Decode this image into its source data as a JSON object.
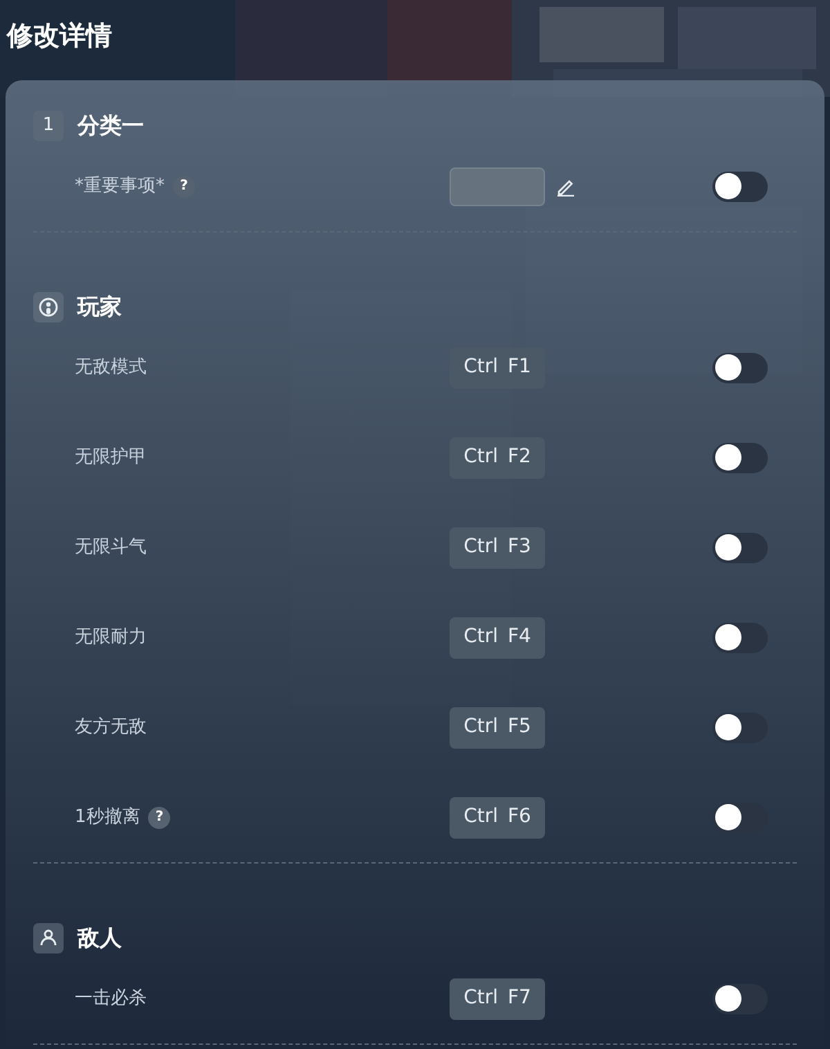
{
  "title": "修改详情",
  "sections": [
    {
      "badge": {
        "kind": "number",
        "text": "1"
      },
      "title": "分类一",
      "rows": [
        {
          "label": "*重要事项*",
          "help": "?",
          "control": {
            "kind": "input"
          },
          "on": false
        }
      ]
    },
    {
      "badge": {
        "kind": "player"
      },
      "title": "玩家",
      "rows": [
        {
          "label": "无敌模式",
          "control": {
            "kind": "hotkey",
            "keys": [
              "Ctrl",
              "F1"
            ]
          },
          "on": false
        },
        {
          "label": "无限护甲",
          "control": {
            "kind": "hotkey",
            "keys": [
              "Ctrl",
              "F2"
            ]
          },
          "on": false
        },
        {
          "label": "无限斗气",
          "control": {
            "kind": "hotkey",
            "keys": [
              "Ctrl",
              "F3"
            ]
          },
          "on": false
        },
        {
          "label": "无限耐力",
          "control": {
            "kind": "hotkey",
            "keys": [
              "Ctrl",
              "F4"
            ]
          },
          "on": false
        },
        {
          "label": "友方无敌",
          "control": {
            "kind": "hotkey",
            "keys": [
              "Ctrl",
              "F5"
            ]
          },
          "on": false
        },
        {
          "label": "1秒撤离",
          "help": "?",
          "control": {
            "kind": "hotkey",
            "keys": [
              "Ctrl",
              "F6"
            ]
          },
          "on": false
        }
      ]
    },
    {
      "badge": {
        "kind": "person"
      },
      "title": "敌人",
      "rows": [
        {
          "label": "一击必杀",
          "control": {
            "kind": "hotkey",
            "keys": [
              "Ctrl",
              "F7"
            ]
          },
          "on": false
        }
      ]
    }
  ]
}
